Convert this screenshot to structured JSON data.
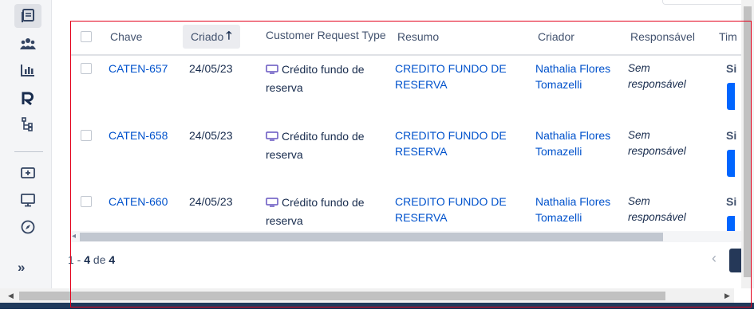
{
  "sidebar": {
    "items": [
      {
        "name": "issues-icon"
      },
      {
        "name": "team-icon"
      },
      {
        "name": "reports-icon"
      },
      {
        "name": "r-app-icon"
      },
      {
        "name": "hierarchy-icon"
      },
      {
        "name": "add-shortcut-icon"
      },
      {
        "name": "monitor-icon"
      },
      {
        "name": "compass-icon"
      }
    ],
    "expand_label": "»"
  },
  "table": {
    "columns": {
      "chave": "Chave",
      "criado": "Criado",
      "sort_arrow": "🡑",
      "customer_request_type": "Customer Request Type",
      "resumo": "Resumo",
      "criador": "Criador",
      "responsavel": "Responsável",
      "cut": "Tim"
    },
    "rows": [
      {
        "chave": "CATEN-657",
        "criado": "24/05/23",
        "request_type": "Crédito fundo de reserva",
        "resumo": "CREDITO FUNDO DE RESERVA",
        "criador": "Nathalia Flores Tomazelli",
        "responsavel": "Sem responsável",
        "cut": "Si"
      },
      {
        "chave": "CATEN-658",
        "criado": "24/05/23",
        "request_type": "Crédito fundo de reserva",
        "resumo": "CREDITO FUNDO DE RESERVA",
        "criador": "Nathalia Flores Tomazelli",
        "responsavel": "Sem responsável",
        "cut": "Si"
      },
      {
        "chave": "CATEN-660",
        "criado": "24/05/23",
        "request_type": "Crédito fundo de reserva",
        "resumo": "CREDITO FUNDO DE RESERVA",
        "criador": "Nathalia Flores Tomazelli",
        "responsavel": "Sem responsável",
        "cut": "Si"
      }
    ]
  },
  "pagination": {
    "start": "1",
    "sep": " - ",
    "end": "4",
    "de": " de ",
    "total": "4",
    "prev": "‹"
  },
  "colors": {
    "link": "#0052cc",
    "frame": "#e3001b",
    "request_icon": "#6554c0"
  }
}
